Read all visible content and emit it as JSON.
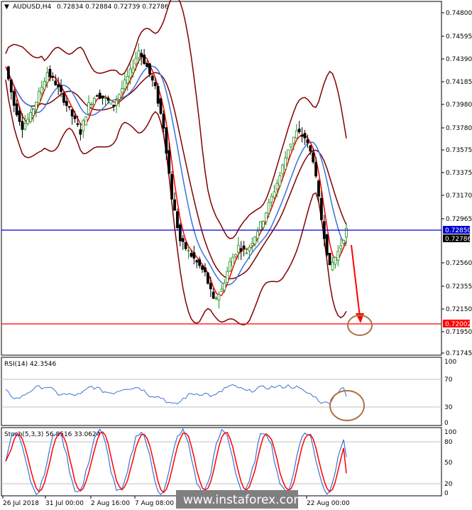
{
  "header": {
    "symbol": "AUDUSD,H4",
    "ohlc": "0.72834 0.72884 0.72739 0.72786"
  },
  "price_axis": {
    "ticks": [
      "0.74800",
      "0.74595",
      "0.74390",
      "0.74185",
      "0.73980",
      "0.73780",
      "0.73575",
      "0.73375",
      "0.73170",
      "0.72965",
      "0.72560",
      "0.72355",
      "0.72150",
      "0.71950",
      "0.71745"
    ]
  },
  "price_tags": {
    "resistance": "0.72850",
    "current": "0.72786",
    "target": "0.72002"
  },
  "rsi": {
    "label": "RSI(14) 42.3546",
    "ticks": [
      "100",
      "70",
      "30",
      "0"
    ]
  },
  "stoch": {
    "label": "Stoch(5,3,3) 56.8516 33.0624",
    "ticks": [
      "100",
      "80",
      "50",
      "20",
      "0"
    ]
  },
  "time_axis": {
    "ticks": [
      "26 Jul 2018",
      "31 Jul 00:00",
      "2 Aug 16:00",
      "7 Aug 08:00",
      "",
      "",
      "22 Aug 00:00"
    ]
  },
  "watermark": "www.instaforex.com",
  "colors": {
    "up_candle": "#1f8a1f",
    "down_candle": "#000000",
    "bollinger": "#800000",
    "fast_ma": "#ff0000",
    "slow_ma": "#3b73d8",
    "resistance_line": "#0000cc",
    "support_line": "#ff0000",
    "forecast_arrow": "#ff0000",
    "circle": "#b07040"
  },
  "chart_data": {
    "type": "candlestick",
    "symbol": "AUDUSD",
    "timeframe": "H4",
    "ylim": [
      0.7165,
      0.749
    ],
    "x": [
      "26 Jul 2018",
      "31 Jul 00:00",
      "2 Aug 16:00",
      "7 Aug 08:00",
      "22 Aug 00:00"
    ],
    "close_path": [
      0.743,
      0.7395,
      0.7375,
      0.7385,
      0.7405,
      0.7425,
      0.7415,
      0.74,
      0.7385,
      0.737,
      0.7395,
      0.7405,
      0.74,
      0.7395,
      0.741,
      0.7425,
      0.7445,
      0.743,
      0.741,
      0.7375,
      0.731,
      0.727,
      0.726,
      0.725,
      0.724,
      0.7215,
      0.7225,
      0.725,
      0.7265,
      0.726,
      0.7275,
      0.729,
      0.731,
      0.733,
      0.7355,
      0.737,
      0.7365,
      0.7345,
      0.729,
      0.7245,
      0.726,
      0.728
    ],
    "horizontal_lines": [
      {
        "label": "resistance",
        "value": 0.7285
      },
      {
        "label": "support",
        "value": 0.72002
      }
    ],
    "rsi_last": 42.3546,
    "stoch_main": 56.8516,
    "stoch_signal": 33.0624
  }
}
